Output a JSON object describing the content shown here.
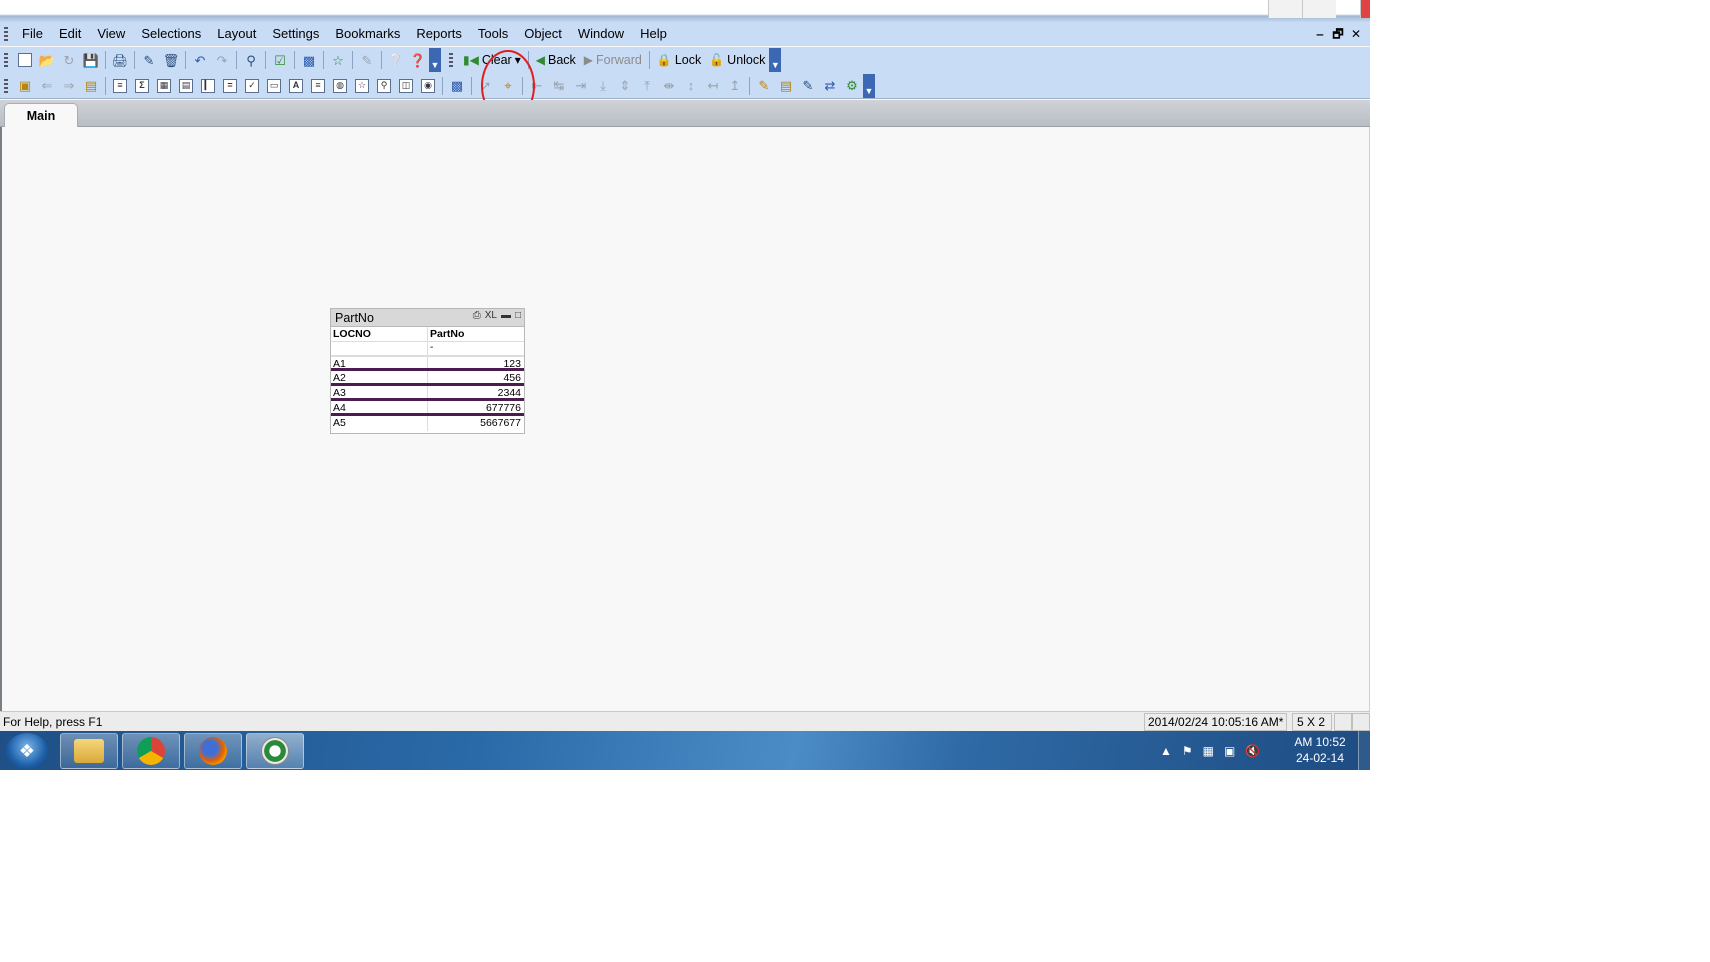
{
  "menubar": {
    "items": [
      "File",
      "Edit",
      "View",
      "Selections",
      "Layout",
      "Settings",
      "Bookmarks",
      "Reports",
      "Tools",
      "Object",
      "Window",
      "Help"
    ]
  },
  "mdi_controls": {
    "minimize": "‒",
    "restore": "🗗",
    "close": "✕"
  },
  "toolbar": {
    "clear_label": "Clear",
    "back_label": "Back",
    "forward_label": "Forward",
    "lock_label": "Lock",
    "unlock_label": "Unlock"
  },
  "tabs": [
    {
      "label": "Main",
      "active": true
    }
  ],
  "table_box": {
    "caption": "PartNo",
    "caption_xl": "XL",
    "columns": [
      "LOCNO",
      "PartNo"
    ],
    "filter_values": [
      "",
      "-"
    ],
    "rows": [
      {
        "locno": "A1",
        "partno": "123"
      },
      {
        "locno": "A2",
        "partno": "456"
      },
      {
        "locno": "A3",
        "partno": "2344"
      },
      {
        "locno": "A4",
        "partno": "677776"
      },
      {
        "locno": "A5",
        "partno": "5667677"
      }
    ]
  },
  "statusbar": {
    "help_text": "For Help, press F1",
    "datetime": "2014/02/24 10:05:16 AM*",
    "dimensions": "5 X 2"
  },
  "taskbar": {
    "clock_time": "AM 10:52",
    "clock_date": "24-02-14",
    "apps": [
      "file-explorer",
      "chrome",
      "firefox",
      "qlikview"
    ]
  },
  "colors": {
    "toolbar_bg": "#c9dcf5",
    "row_separator": "#4b1c4f",
    "annotation": "#e01e1e"
  },
  "icons": {
    "toolbar1": [
      "new-doc-icon",
      "open-folder-icon",
      "reload-icon",
      "save-icon",
      "print-icon",
      "edit-script-icon",
      "reload-doc-icon",
      "undo-icon",
      "redo-icon",
      "search-icon",
      "validate-icon",
      "chart-wizard-icon",
      "bookmark-star-icon",
      "edit-icon",
      "help-icon",
      "whats-this-icon"
    ],
    "toolbar2": [
      "new-sheet-icon",
      "sheet-left-icon",
      "sheet-right-icon",
      "sheet-props-icon",
      "list-box-icon",
      "sum-icon",
      "table-icon",
      "pivot-icon",
      "bar-chart-icon",
      "input-box-icon",
      "multi-box-icon",
      "button-icon",
      "text-object-icon",
      "line-arrow-icon",
      "slider-icon",
      "bookmark-object-icon",
      "search-object-icon",
      "container-icon",
      "current-selections-icon",
      "design-grid-icon",
      "arrow-tool-icon",
      "snap-grid-icon",
      "align-left-icon",
      "align-center-icon",
      "align-right-icon",
      "align-bottom-icon",
      "align-middle-icon",
      "align-top-icon",
      "space-horizontal-icon",
      "space-vertical-icon",
      "adjust-left-icon",
      "adjust-top-icon",
      "copy-format-icon",
      "new-object-icon",
      "object-properties-icon",
      "link-icon",
      "server-icon"
    ]
  }
}
